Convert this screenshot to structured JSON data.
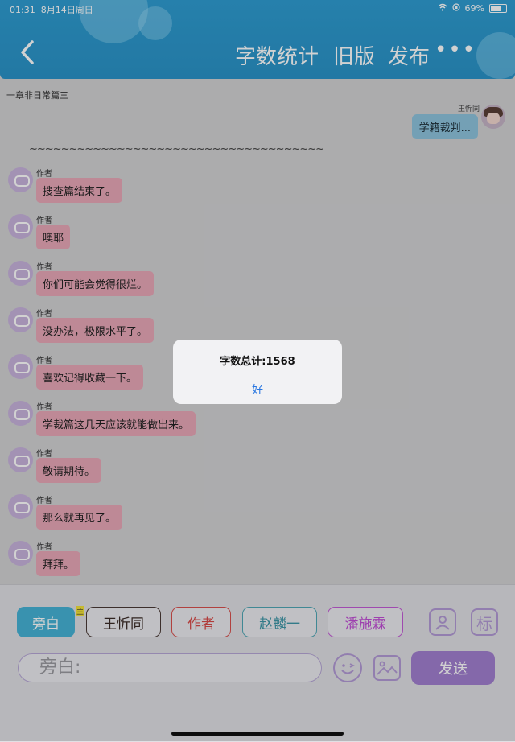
{
  "status_bar": {
    "time": "01:31",
    "date": "8月14日周日",
    "battery": "69%"
  },
  "header": {
    "nav": [
      {
        "label": "字数统计"
      },
      {
        "label": "旧版"
      },
      {
        "label": "发布"
      }
    ],
    "more": "•••"
  },
  "chat": {
    "chapter_title": "一章非日常篇三",
    "my_message": {
      "sender": "王忻同",
      "text": "学籍裁判..."
    },
    "separator": "~~~~~~~~~~~~~~~~~~~~~~~~~~~~~~~~~~~~~",
    "messages": [
      {
        "sender": "作者",
        "text": "搜查篇结束了。"
      },
      {
        "sender": "作者",
        "text": "噢耶"
      },
      {
        "sender": "作者",
        "text": "你们可能会觉得很烂。"
      },
      {
        "sender": "作者",
        "text": "没办法，极限水平了。"
      },
      {
        "sender": "作者",
        "text": "喜欢记得收藏一下。"
      },
      {
        "sender": "作者",
        "text": "学裁篇这几天应该就能做出来。"
      },
      {
        "sender": "作者",
        "text": "敬请期待。"
      },
      {
        "sender": "作者",
        "text": "那么就再见了。"
      },
      {
        "sender": "作者",
        "text": "拜拜。"
      }
    ]
  },
  "roles": [
    {
      "label": "旁白",
      "color": "#46b3d6"
    },
    {
      "label": "王忻同",
      "color": "#4a3a36"
    },
    {
      "label": "作者",
      "color": "#d8504e"
    },
    {
      "label": "赵麟一",
      "color": "#4fa6b5"
    },
    {
      "label": "潘施霖",
      "color": "#c35bd6"
    }
  ],
  "main_badge": "主",
  "icons": {
    "contact": "person-card-icon",
    "mark": "标"
  },
  "composer": {
    "placeholder": "旁白:",
    "send_label": "发送"
  },
  "alert": {
    "title": "字数总计:1568",
    "ok_label": "好"
  },
  "colors": {
    "header": "#2f9dd2",
    "bubble_author": "#e8a8b8",
    "bubble_me": "#8ec4dd",
    "accent": "#a17fd0"
  }
}
